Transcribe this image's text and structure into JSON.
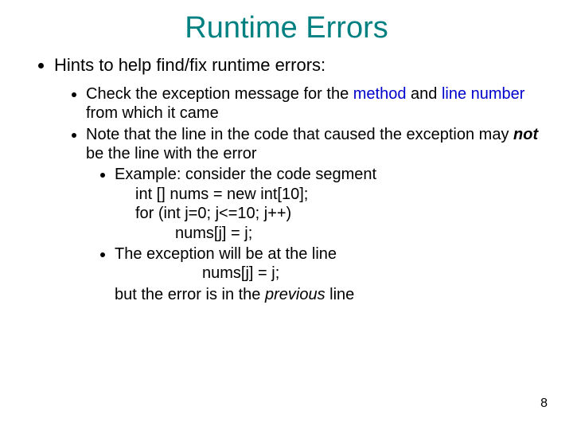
{
  "title": "Runtime Errors",
  "main_bullet": "Hints to help find/fix runtime errors:",
  "sub1": {
    "t1": "Check the exception message for the ",
    "method": "method",
    "t2": " and ",
    "line_number": "line number",
    "t3": " from which it came"
  },
  "sub2": {
    "t1": "Note that the line in the code that caused the exception may ",
    "not": "not",
    "t2": " be the line with the error"
  },
  "example_label": "Example: consider the code segment",
  "code": {
    "l1": "int [] nums = new int[10];",
    "l2": "for (int j=0; j<=10; j++)",
    "l3": "nums[j] = j;"
  },
  "exc": {
    "t1": "The exception will be at the line",
    "code": "nums[j] = j;",
    "t2a": "but the error is in the ",
    "prev": "previous",
    "t2b": " line"
  },
  "page_number": "8"
}
